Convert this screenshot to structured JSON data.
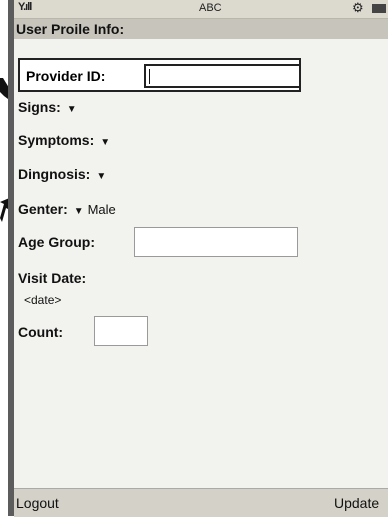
{
  "status": {
    "signal": "Y.ıll",
    "mode": "ABC",
    "icons": [
      "signal-icon",
      "settings-icon",
      "battery-icon"
    ]
  },
  "title": "User Proile Info:",
  "fields": {
    "provider_label": "Provider ID:",
    "provider_value": "",
    "signs_label": "Signs:",
    "symptoms_label": "Symptoms:",
    "diagnosis_label": "Dingnosis:",
    "gender_label": "Genter:",
    "gender_value": "Male",
    "age_label": "Age Group:",
    "age_value": "",
    "visit_label": "Visit Date:",
    "visit_value": "<date>",
    "count_label": "Count:",
    "count_value": ""
  },
  "softkeys": {
    "left": "Logout",
    "right": "Update"
  }
}
